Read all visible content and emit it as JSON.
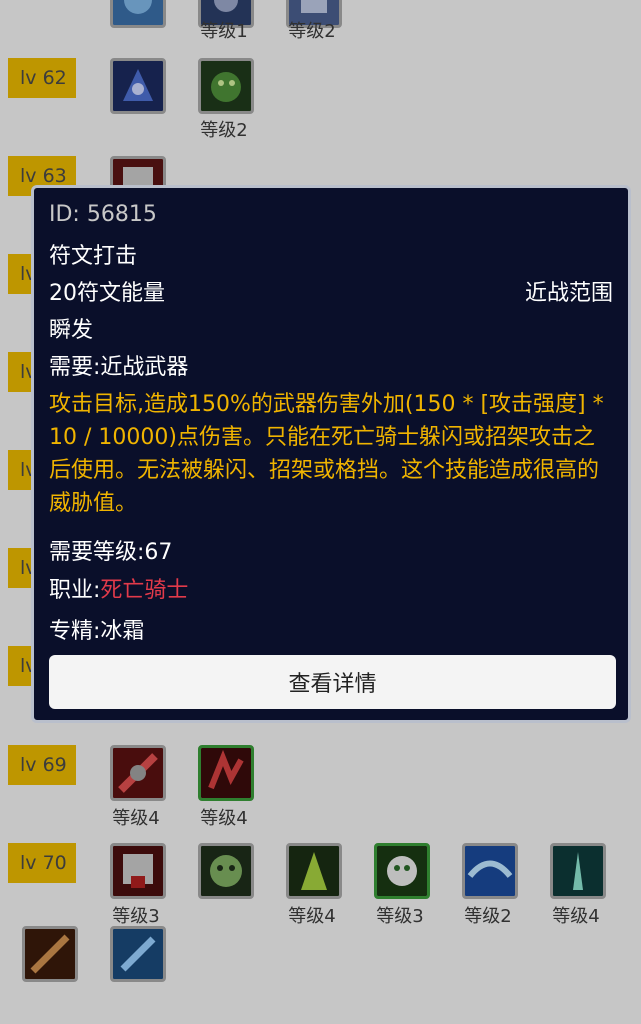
{
  "rows": [
    {
      "level": "",
      "skills": [
        {
          "label": "等级1"
        },
        {
          "label": "等级2"
        }
      ]
    },
    {
      "level": "lv 62",
      "skills": [
        {
          "label": ""
        },
        {
          "label": "等级2"
        }
      ]
    },
    {
      "level": "lv 63"
    },
    {
      "level": "lv 69",
      "skills": [
        {
          "label": "等级4"
        },
        {
          "label": "等级4"
        }
      ]
    },
    {
      "level": "lv 70",
      "skills": [
        {
          "label": "等级3"
        },
        {
          "label": ""
        },
        {
          "label": "等级4"
        },
        {
          "label": "等级3"
        },
        {
          "label": "等级2"
        },
        {
          "label": "等级4"
        }
      ]
    }
  ],
  "tooltip": {
    "id_label": "ID:  56815",
    "name": "符文打击",
    "cost": "20符文能量",
    "range": "近战范围",
    "cast": "瞬发",
    "requires": "需要:近战武器",
    "description": "攻击目标,造成150%的武器伤害外加(150 * [攻击强度] * 10 / 10000)点伤害。只能在死亡骑士躲闪或招架攻击之后使用。无法被躲闪、招架或格挡。这个技能造成很高的威胁值。",
    "level_req_label": "需要等级:",
    "level_req_value": "67",
    "class_label": "职业:",
    "class_value": "死亡骑士",
    "spec_label": "专精:",
    "spec_value": "冰霜",
    "details_button": "查看详情"
  },
  "colors": {
    "badge": "#e8b800",
    "tooltip_bg": "#0a0f2a",
    "desc_text": "#f0b400",
    "class_text": "#e23a4a"
  }
}
